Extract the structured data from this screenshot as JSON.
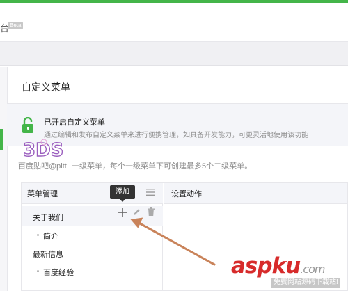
{
  "header": {
    "brand_partial": "台",
    "beta_badge": "Beta"
  },
  "page": {
    "title": "自定义菜单"
  },
  "notice": {
    "title": "已开启自定义菜单",
    "description": "通过编辑和发布自定义菜单来进行便携管理，如具备开发能力，可更灵活地使用该功能"
  },
  "watermark": {
    "logo_text": "3DS",
    "caption": "百度贴吧@pitt"
  },
  "hint": "一级菜单，每个一级菜单下可创建最多5个二级菜单。",
  "menu_panel": {
    "header_label": "菜单管理",
    "tooltip": "添加",
    "settings_header": "设置动作",
    "items": [
      {
        "label": "关于我们",
        "level": 1
      },
      {
        "label": "简介",
        "level": 2
      },
      {
        "label": "最新信息",
        "level": 1
      },
      {
        "label": "百度经验",
        "level": 2
      }
    ]
  },
  "site_watermark": {
    "name": "aspku",
    "tld": ".com",
    "subtitle": "免费网站源码下载站!"
  },
  "colors": {
    "brand_green": "#44b549",
    "arrow": "#c9835a",
    "logo_red": "#d72b2b"
  }
}
